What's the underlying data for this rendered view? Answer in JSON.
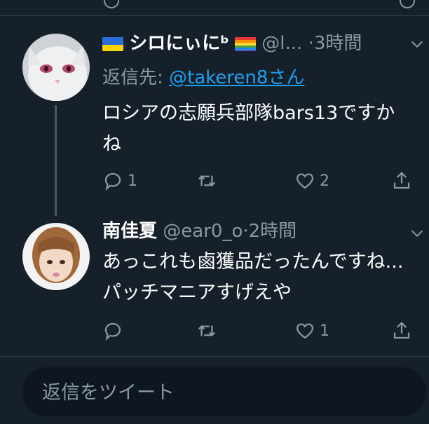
{
  "tweets": [
    {
      "name": "シロにぃにᵇ",
      "handle": "@l...",
      "separator": "·",
      "time": "3時間",
      "reply_to_prefix": "返信先: ",
      "reply_to_handle": "@takeren8さん",
      "text": "ロシアの志願兵部隊bars13ですかね",
      "flag_left_icon": "ukraine-flag-icon",
      "flag_right_icon": "rainbow-flag-icon",
      "actions": {
        "reply_count": "1",
        "retweet_count": "",
        "like_count": "2"
      }
    },
    {
      "name": "南佳夏",
      "handle": "@ear0_o",
      "separator": "·",
      "time": "2時間",
      "text": "あっこれも鹵獲品だったんですね...パッチマニアすげえや",
      "actions": {
        "reply_count": "",
        "retweet_count": "",
        "like_count": "1"
      }
    }
  ],
  "compose": {
    "placeholder": "返信をツイート"
  },
  "colors": {
    "background": "#15202b",
    "secondary_text": "#8899a6",
    "link": "#1da1f2",
    "divider": "#38444d"
  }
}
